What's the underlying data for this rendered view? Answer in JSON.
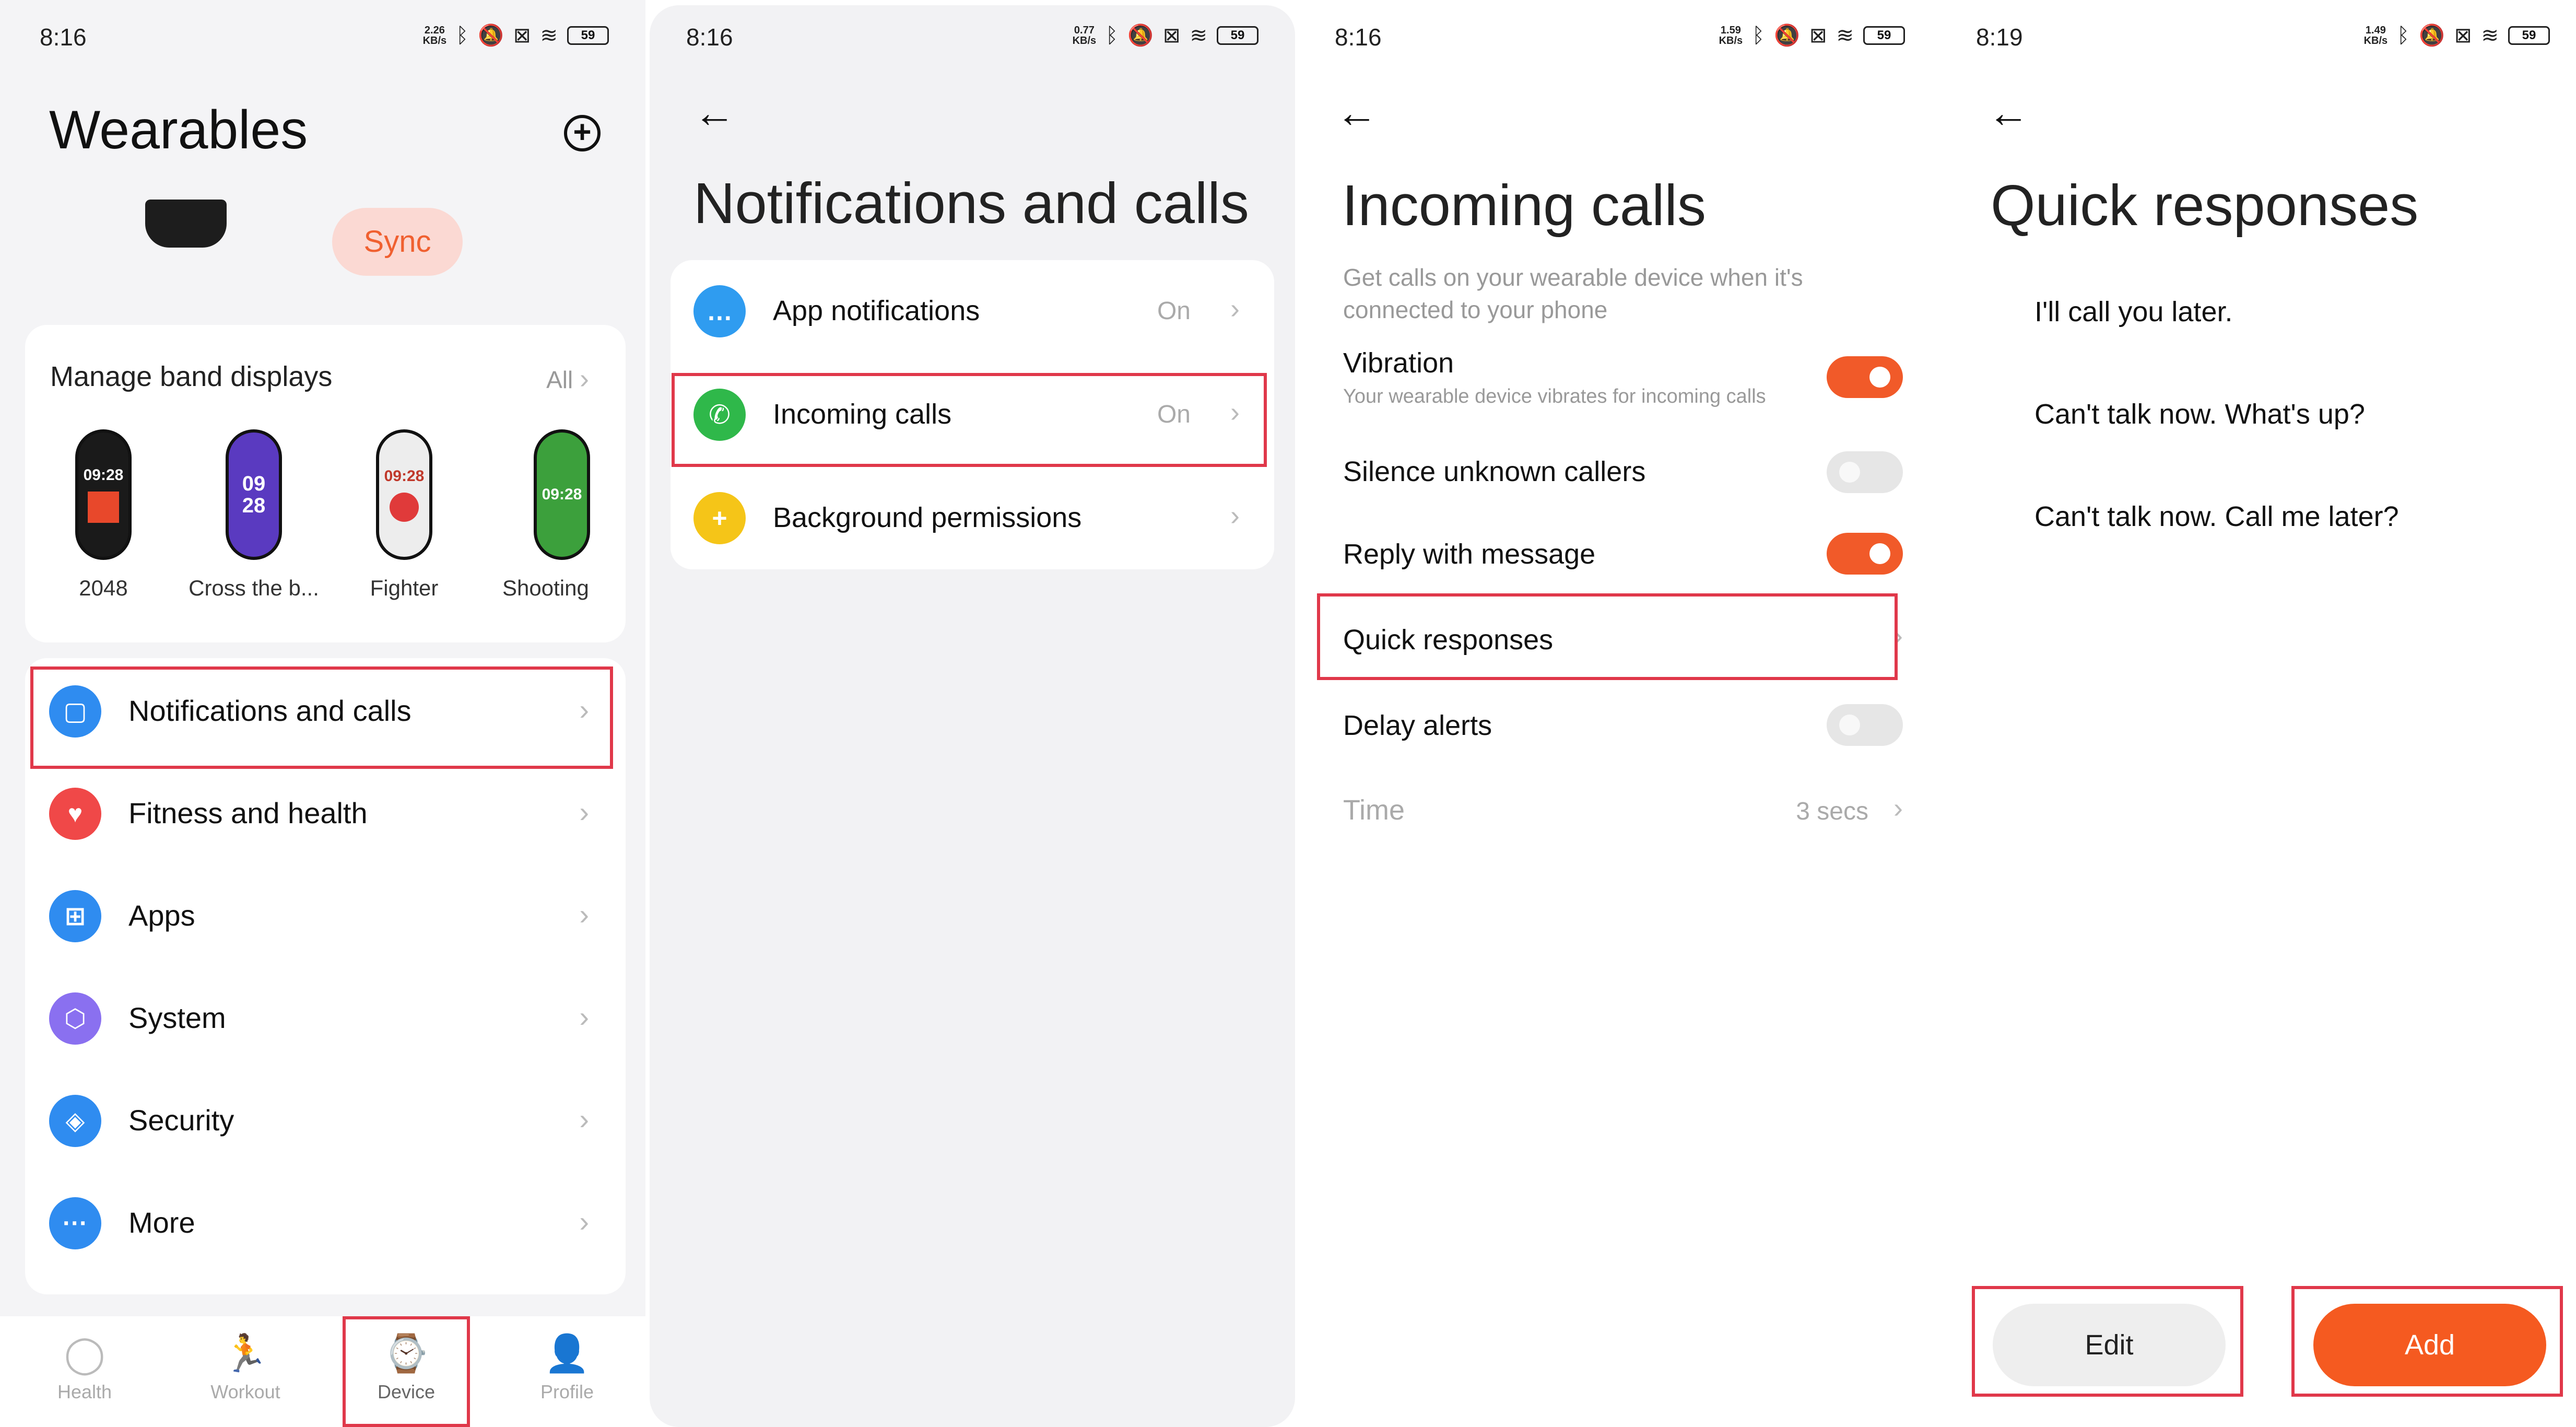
{
  "status_bars": [
    {
      "time": "8:16",
      "speed": "2.26\nKB/s",
      "battery": "59"
    },
    {
      "time": "8:16",
      "speed": "0.77\nKB/s",
      "battery": "59"
    },
    {
      "time": "8:16",
      "speed": "1.59\nKB/s",
      "battery": "59"
    },
    {
      "time": "8:19",
      "speed": "1.49\nKB/s",
      "battery": "59"
    }
  ],
  "wearables": {
    "title": "Wearables",
    "sync_label": "Sync",
    "displays": {
      "title": "Manage band displays",
      "all_label": "All",
      "faces": [
        {
          "label": "2048",
          "screen_text": "09:28",
          "color": "#e8482b"
        },
        {
          "label": "Cross the b...",
          "screen_text": "09\n28",
          "color": "#5a3ac0"
        },
        {
          "label": "Fighter",
          "screen_text": "09:28",
          "color": "#e03a3a"
        },
        {
          "label": "Shooting",
          "screen_text": "09:28",
          "color": "#3ca03c"
        }
      ]
    },
    "menu": [
      {
        "label": "Notifications and calls",
        "icon": "notification-icon",
        "color": "#2f8cf0"
      },
      {
        "label": "Fitness and health",
        "icon": "heart-icon",
        "color": "#f04848"
      },
      {
        "label": "Apps",
        "icon": "apps-grid-icon",
        "color": "#2f8cf0"
      },
      {
        "label": "System",
        "icon": "system-gear-icon",
        "color": "#8a70f0"
      },
      {
        "label": "Security",
        "icon": "shield-icon",
        "color": "#2f8cf0"
      },
      {
        "label": "More",
        "icon": "more-dots-icon",
        "color": "#2f8cf0"
      }
    ],
    "nav": [
      {
        "label": "Health",
        "icon": "health-ring-icon"
      },
      {
        "label": "Workout",
        "icon": "runner-icon"
      },
      {
        "label": "Device",
        "icon": "watch-icon",
        "active": true
      },
      {
        "label": "Profile",
        "icon": "profile-icon"
      }
    ]
  },
  "notifications": {
    "title": "Notifications and calls",
    "rows": [
      {
        "label": "App notifications",
        "value": "On",
        "icon": "chat-bubble-icon",
        "color": "#2f9cf0"
      },
      {
        "label": "Incoming calls",
        "value": "On",
        "icon": "phone-icon",
        "color": "#2fb84a"
      },
      {
        "label": "Background permissions",
        "value": "",
        "icon": "shield-plus-icon",
        "color": "#f5c518"
      }
    ]
  },
  "incoming_calls": {
    "title": "Incoming calls",
    "description": "Get calls on your wearable device when it's connected to your phone",
    "vibration": {
      "label": "Vibration",
      "sub": "Your wearable device vibrates for incoming calls",
      "on": true
    },
    "silence_unknown": {
      "label": "Silence unknown callers",
      "on": false
    },
    "reply_with_message": {
      "label": "Reply with message",
      "on": true
    },
    "quick_responses": {
      "label": "Quick responses"
    },
    "delay_alerts": {
      "label": "Delay alerts",
      "on": false
    },
    "time": {
      "label": "Time",
      "value": "3 secs"
    }
  },
  "quick_responses": {
    "title": "Quick responses",
    "responses": [
      "I'll call you later.",
      "Can't talk now. What's up?",
      "Can't talk now. Call me later?"
    ],
    "edit_label": "Edit",
    "add_label": "Add"
  },
  "colors": {
    "accent": "#f15a29",
    "highlight_box": "#e0384a"
  }
}
